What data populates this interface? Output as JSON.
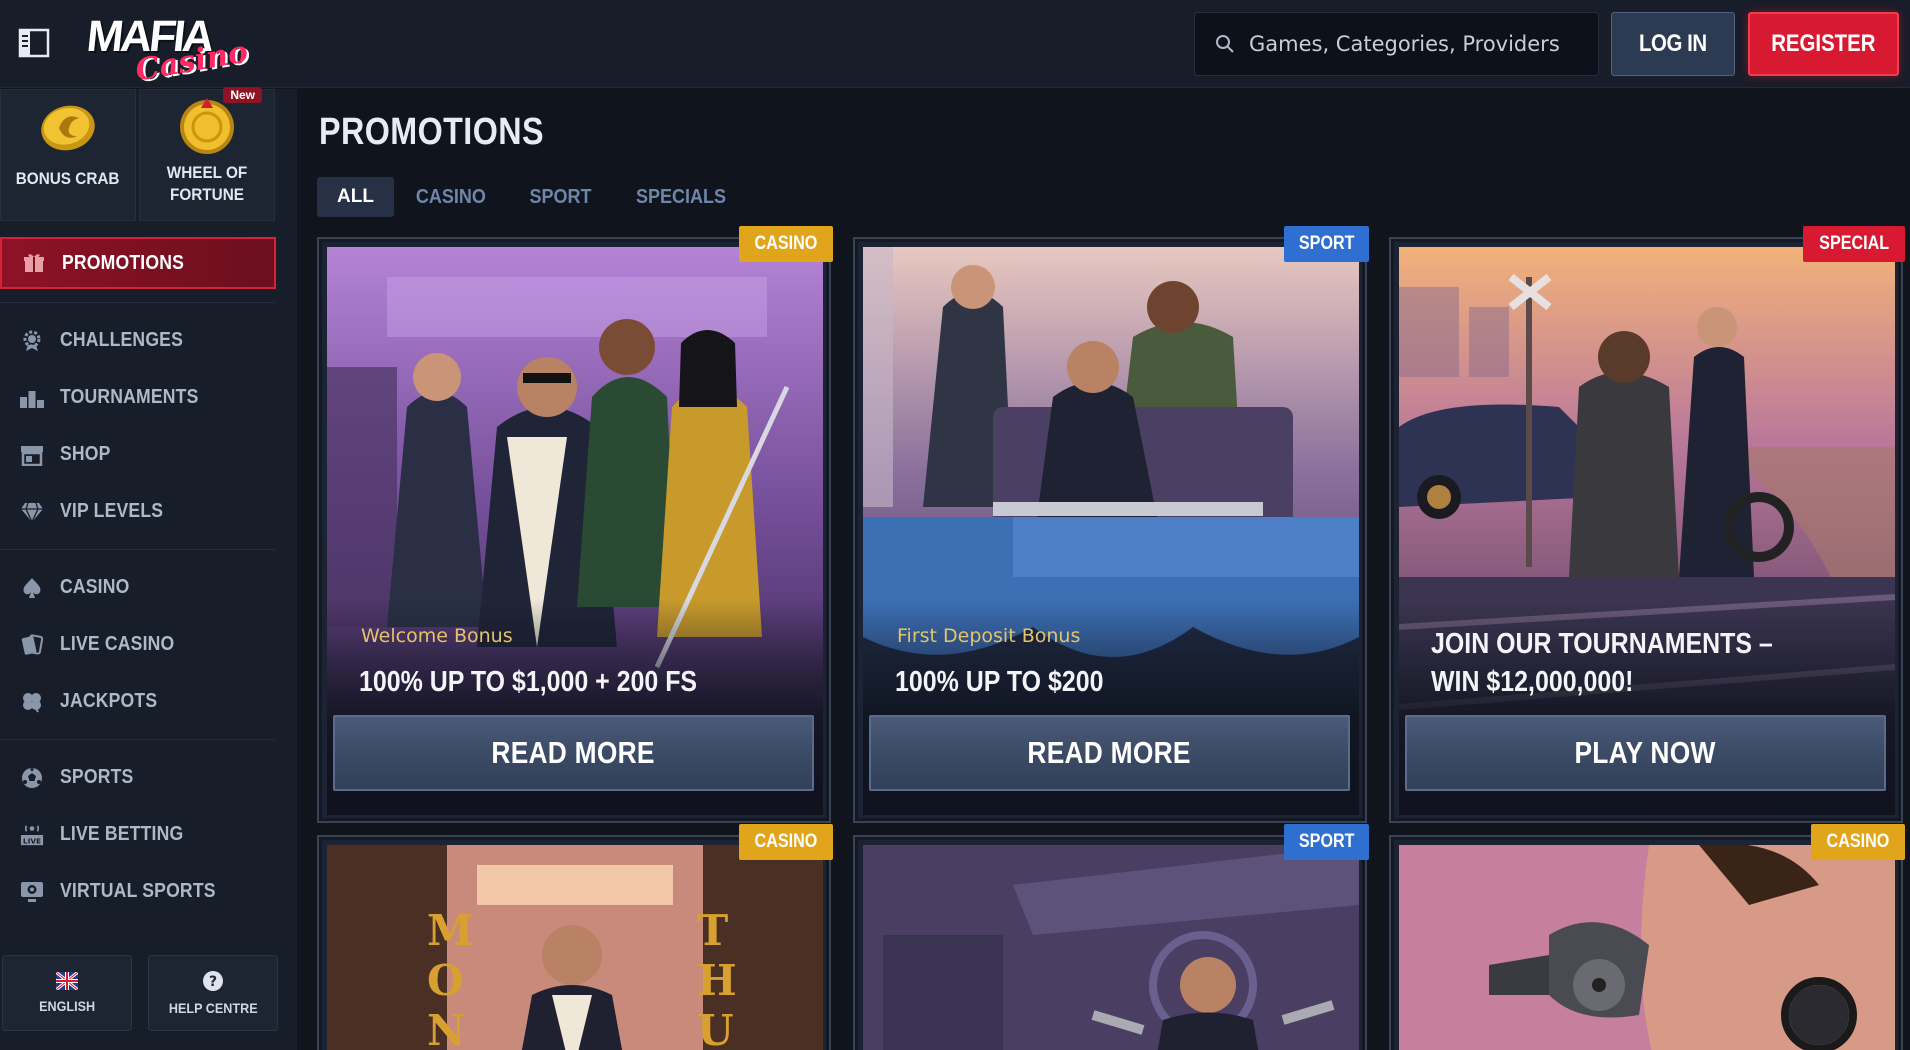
{
  "header": {
    "logo_line1": "MAFIA",
    "logo_line2": "Casino",
    "search_placeholder": "Games, Categories, Providers",
    "login_label": "LOG IN",
    "register_label": "REGISTER"
  },
  "sidebar": {
    "quick": [
      {
        "label": "BONUS CRAB",
        "icon": "bonus-crab-coin-icon"
      },
      {
        "label": "WHEEL OF FORTUNE",
        "icon": "wheel-of-fortune-coin-icon",
        "badge": "New"
      }
    ],
    "groups": [
      [
        {
          "label": "PROMOTIONS",
          "icon": "gift-icon",
          "active": true
        }
      ],
      [
        {
          "label": "CHALLENGES",
          "icon": "gear-badge-icon"
        },
        {
          "label": "TOURNAMENTS",
          "icon": "podium-icon"
        },
        {
          "label": "SHOP",
          "icon": "shop-icon"
        },
        {
          "label": "VIP LEVELS",
          "icon": "diamond-icon"
        }
      ],
      [
        {
          "label": "CASINO",
          "icon": "spade-icon"
        },
        {
          "label": "LIVE CASINO",
          "icon": "live-cards-icon"
        },
        {
          "label": "JACKPOTS",
          "icon": "clover-icon"
        }
      ],
      [
        {
          "label": "SPORTS",
          "icon": "soccer-ball-icon"
        },
        {
          "label": "LIVE BETTING",
          "icon": "live-broadcast-icon"
        },
        {
          "label": "VIRTUAL SPORTS",
          "icon": "virtual-monitor-icon"
        }
      ]
    ],
    "language_label": "ENGLISH",
    "help_label": "HELP CENTRE"
  },
  "main": {
    "title": "PROMOTIONS",
    "tabs": [
      "ALL",
      "CASINO",
      "SPORT",
      "SPECIALS"
    ],
    "active_tab": "ALL",
    "cards": [
      {
        "badge": "CASINO",
        "subtitle": "Welcome Bonus",
        "title": "100% UP TO $1,000 + 200 FS",
        "cta": "READ MORE"
      },
      {
        "badge": "SPORT",
        "subtitle": "First Deposit Bonus",
        "title": "100% UP TO $200",
        "cta": "READ MORE"
      },
      {
        "badge": "SPECIAL",
        "subtitle": "",
        "title": "JOIN OUR TOURNAMENTS – WIN $12,000,000!",
        "cta": "PLAY NOW"
      },
      {
        "badge": "CASINO"
      },
      {
        "badge": "SPORT"
      },
      {
        "badge": "CASINO"
      }
    ]
  },
  "colors": {
    "background": "#0f141d",
    "panel": "#171d29",
    "accent_red": "#d71a32",
    "casino_badge": "#e1a51c",
    "sport_badge": "#2e6fd1",
    "subtitle_gold": "#e3c46a"
  }
}
